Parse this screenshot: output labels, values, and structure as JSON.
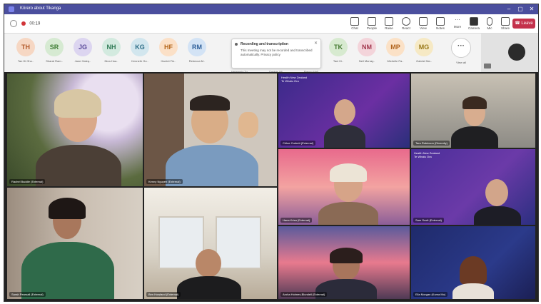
{
  "window": {
    "title": "Kōrero about Tikanga"
  },
  "toolbar": {
    "timer": "00:19",
    "buttons": [
      "Chat",
      "People",
      "Raise",
      "React",
      "View",
      "Notes",
      "More"
    ],
    "camera_label": "Camera",
    "mic_label": "Mic",
    "share_label": "Share",
    "leave_label": "Leave"
  },
  "participants": [
    {
      "initials": "TH",
      "name": "Tan Hi Gho..",
      "color": "#f6d7c3",
      "text_color": "#b35c2e"
    },
    {
      "initials": "SR",
      "name": "Sharat Ram..",
      "color": "#d6ead2",
      "text_color": "#3f7d35"
    },
    {
      "initials": "JG",
      "name": "Jane Galeq..",
      "color": "#dcd5f0",
      "text_color": "#5a4a9a"
    },
    {
      "initials": "NH",
      "name": "Nina Hua..",
      "color": "#d3eadf",
      "text_color": "#2f7a55"
    },
    {
      "initials": "KG",
      "name": "Kenneth Go..",
      "color": "#d2e6ee",
      "text_color": "#2d6d86"
    },
    {
      "initials": "HF",
      "name": "Harriet Fie..",
      "color": "#fbe0c7",
      "text_color": "#b4661b"
    },
    {
      "initials": "RM",
      "name": "Rebecca M..",
      "color": "#d3e3f5",
      "text_color": "#2e5f99"
    },
    {
      "initials": "TK",
      "name": "Tani Ki..",
      "color": "#d7ead0",
      "text_color": "#43782f"
    },
    {
      "initials": "NM",
      "name": "Neil Murray..",
      "color": "#f3d4da",
      "text_color": "#a3384e"
    },
    {
      "initials": "MP",
      "name": "Michelle Pa..",
      "color": "#fbe1c6",
      "text_color": "#b0631c"
    },
    {
      "initials": "MG",
      "name": "Gabriel Ma..",
      "color": "#f6e9c4",
      "text_color": "#9a7a1a"
    }
  ],
  "view_all_label": "View all",
  "more_participants_names": [
    "Heremaia Tu..",
    "Debbie Wi..",
    "Flenny Hall.."
  ],
  "recording_notice": {
    "title": "Recording and transcription",
    "body": "This meeting may not be recorded and transcribed automatically. Privacy policy"
  },
  "video_tiles": [
    {
      "label": "Rachel Baddle (External)",
      "bg": "flowers"
    },
    {
      "label": "Kenny Nguyen (External)",
      "bg": "office"
    },
    {
      "label": "Chloe Corbett (External)",
      "bg": "purple",
      "note": "Health New Zealand\nTe Whatu Ora"
    },
    {
      "label": "Tara Robinson (Diversity)",
      "bg": "office2"
    },
    {
      "label": "Hana Krisa (External)",
      "bg": "sunset"
    },
    {
      "label": "Sam Scott (External)",
      "bg": "purple2",
      "note": "Health New Zealand\nTe Whatu Ora"
    },
    {
      "label": "Sarah Pearsall (External)",
      "bg": "blur"
    },
    {
      "label": "Ben Howland (External)",
      "bg": "room"
    },
    {
      "label": "Aroha Holmes-Blundell (External)",
      "bg": "sunset2"
    },
    {
      "label": "Ella Morgan (Kuma Mo)",
      "bg": "navy"
    }
  ]
}
